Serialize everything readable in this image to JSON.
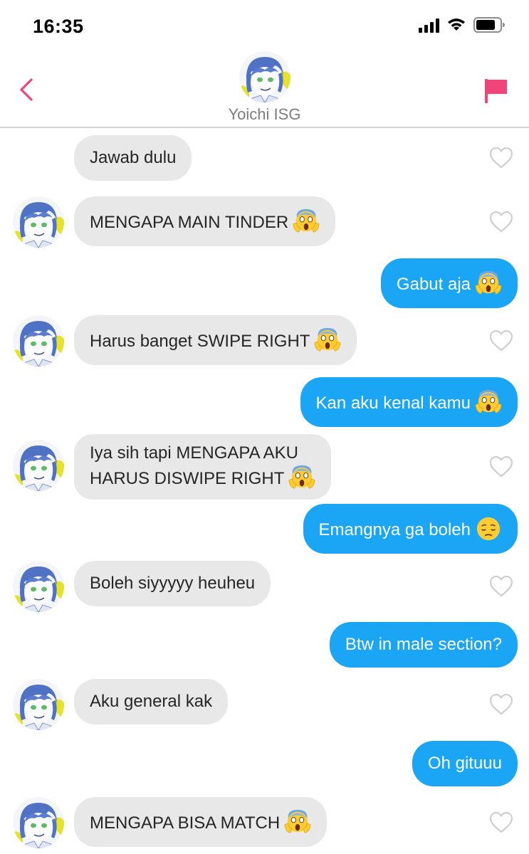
{
  "status_bar": {
    "time": "16:35",
    "signal_icon": "cellular-signal-icon",
    "wifi_icon": "wifi-icon",
    "battery_icon": "battery-icon"
  },
  "header": {
    "contact_name": "Yoichi ISG",
    "back_icon": "chevron-left-icon",
    "report_icon": "flag-icon",
    "accent_color": "#f0447a"
  },
  "colors": {
    "incoming_bubble": "#e8e8e8",
    "outgoing_bubble": "#1aa6f4",
    "like_outline": "#cfcfcf"
  },
  "messages": [
    {
      "direction": "incoming",
      "text": "Jawab dulu"
    },
    {
      "direction": "incoming",
      "text": "MENGAPA MAIN TINDER",
      "emoji": "screaming-face"
    },
    {
      "direction": "outgoing",
      "text": "Gabut aja",
      "emoji": "screaming-face"
    },
    {
      "direction": "incoming",
      "text": "Harus banget SWIPE RIGHT",
      "emoji": "screaming-face"
    },
    {
      "direction": "outgoing",
      "text": "Kan aku kenal kamu",
      "emoji": "screaming-face"
    },
    {
      "direction": "incoming",
      "line1": "Iya sih tapi MENGAPA AKU",
      "line2": "HARUS DISWIPE RIGHT",
      "emoji": "screaming-face"
    },
    {
      "direction": "outgoing",
      "text": "Emangnya ga boleh",
      "emoji": "pensive-face"
    },
    {
      "direction": "incoming",
      "text": "Boleh siyyyyy heuheu"
    },
    {
      "direction": "outgoing",
      "text": "Btw in male section?"
    },
    {
      "direction": "incoming",
      "text": "Aku general kak"
    },
    {
      "direction": "outgoing",
      "text": "Oh gituuu"
    },
    {
      "direction": "incoming",
      "text": "MENGAPA BISA MATCH",
      "emoji": "screaming-face"
    }
  ]
}
